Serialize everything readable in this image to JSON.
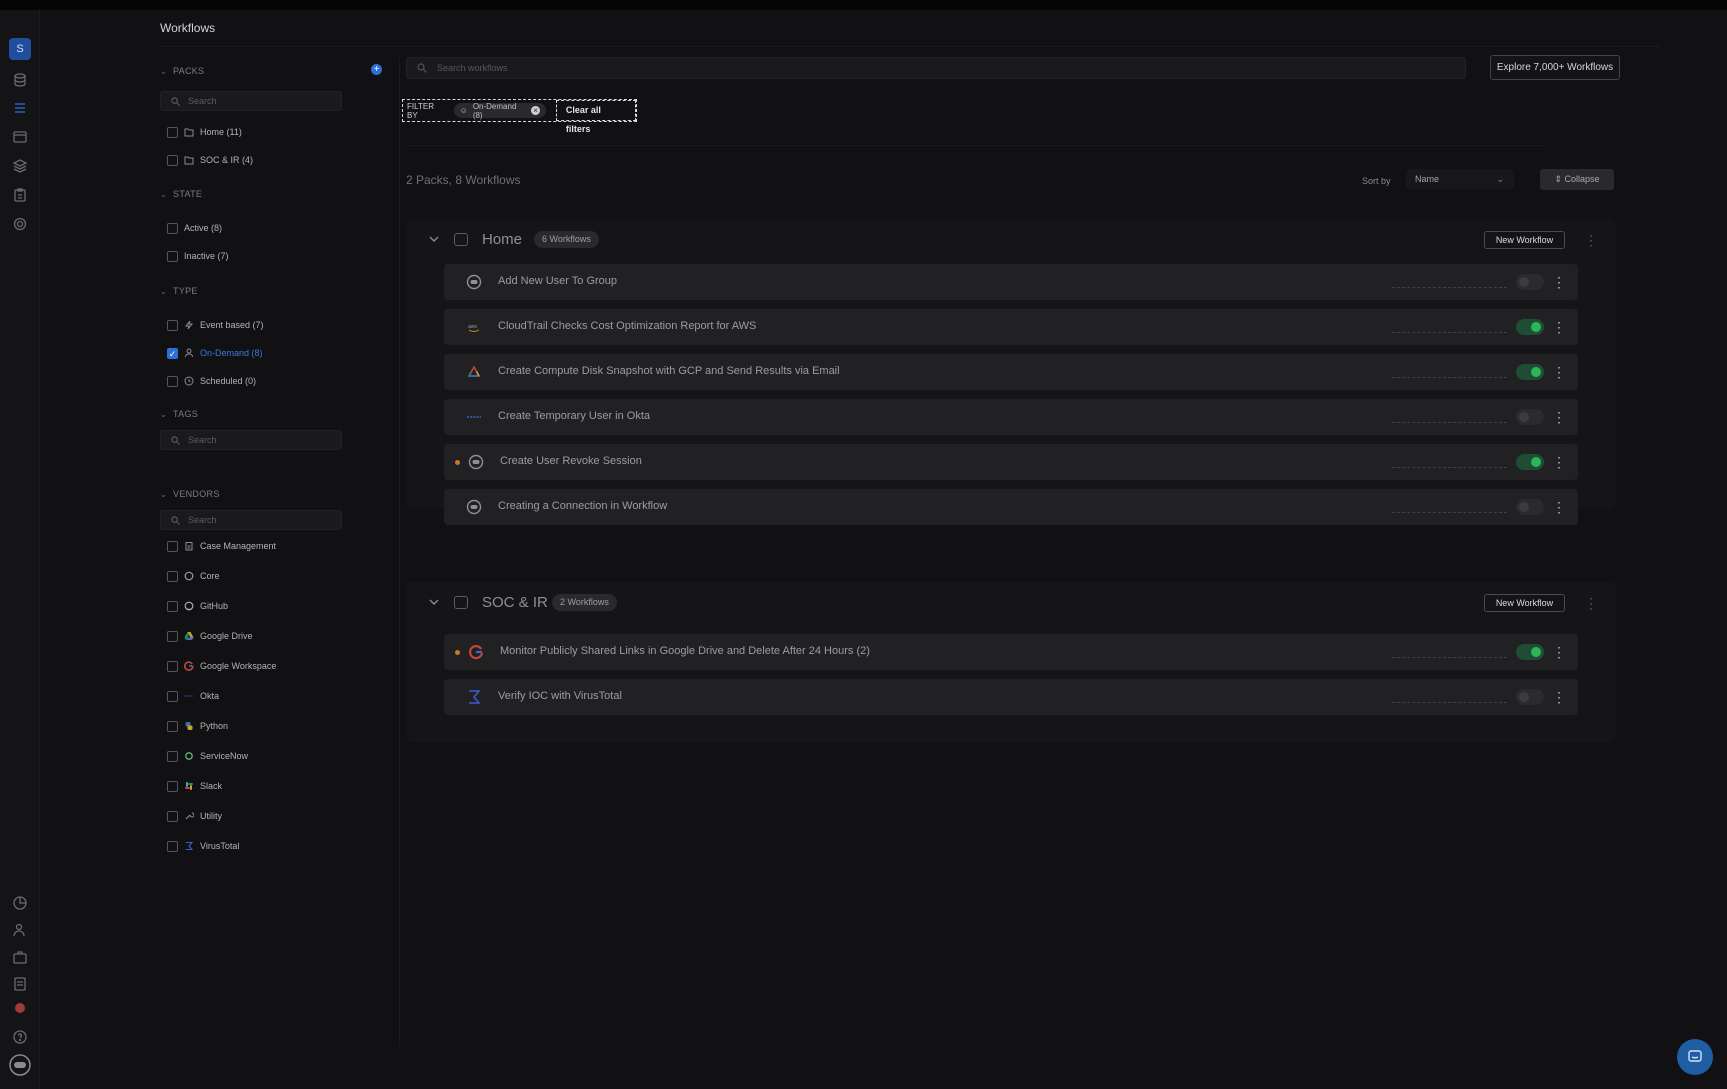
{
  "app": {
    "avatar_letter": "S",
    "page_title": "Workflows"
  },
  "sidebar": {
    "packs_label": "PACKS",
    "packs_search_placeholder": "Search",
    "packs": [
      {
        "label": "Home (11)",
        "checked": false
      },
      {
        "label": "SOC & IR (4)",
        "checked": false
      }
    ],
    "state_label": "STATE",
    "states": [
      {
        "label": "Active (8)",
        "checked": false
      },
      {
        "label": "Inactive (7)",
        "checked": false
      }
    ],
    "type_label": "TYPE",
    "types": [
      {
        "label": "Event based (7)",
        "icon": "bolt-icon",
        "checked": false
      },
      {
        "label": "On-Demand (8)",
        "icon": "user-icon",
        "checked": true
      },
      {
        "label": "Scheduled (0)",
        "icon": "clock-icon",
        "checked": false
      }
    ],
    "tags_label": "TAGS",
    "tags_search_placeholder": "Search",
    "vendors_label": "VENDORS",
    "vendors_search_placeholder": "Search",
    "vendors": [
      {
        "label": "Case Management",
        "icon": "clipboard-icon"
      },
      {
        "label": "Core",
        "icon": "core-icon"
      },
      {
        "label": "GitHub",
        "icon": "github-icon"
      },
      {
        "label": "Google Drive",
        "icon": "google-drive-icon"
      },
      {
        "label": "Google Workspace",
        "icon": "google-icon"
      },
      {
        "label": "Okta",
        "icon": "okta-icon"
      },
      {
        "label": "Python",
        "icon": "python-icon"
      },
      {
        "label": "ServiceNow",
        "icon": "servicenow-icon"
      },
      {
        "label": "Slack",
        "icon": "slack-icon"
      },
      {
        "label": "Utility",
        "icon": "wrench-icon"
      },
      {
        "label": "VirusTotal",
        "icon": "virustotal-icon"
      }
    ]
  },
  "search": {
    "placeholder": "Search workflows"
  },
  "explore_button": "Explore 7,000+ Workflows",
  "filter": {
    "label": "FILTER BY",
    "chip": "On-Demand (8)",
    "clear_label": "Clear all filters"
  },
  "summary": "2 Packs, 8 Workflows",
  "sort": {
    "label": "Sort by",
    "value": "Name"
  },
  "collapse_label": "Collapse",
  "packs": [
    {
      "name": "Home",
      "badge": "6  Workflows",
      "new_label": "New Workflow",
      "workflows": [
        {
          "title": "Add New User To Group",
          "icon": "core-icon",
          "active": false,
          "dot": false
        },
        {
          "title": "CloudTrail Checks Cost Optimization Report for AWS",
          "icon": "aws-icon",
          "active": true,
          "dot": false
        },
        {
          "title": "Create Compute Disk Snapshot with GCP and Send Results via Email",
          "icon": "gcp-icon",
          "active": true,
          "dot": false
        },
        {
          "title": "Create Temporary User in Okta",
          "icon": "okta-icon",
          "active": false,
          "dot": false
        },
        {
          "title": "Create User Revoke Session",
          "icon": "core-icon",
          "active": true,
          "dot": true
        },
        {
          "title": "Creating a Connection in Workflow",
          "icon": "core-icon",
          "active": false,
          "dot": false
        }
      ]
    },
    {
      "name": "SOC & IR",
      "badge": "2  Workflows",
      "new_label": "New Workflow",
      "workflows": [
        {
          "title": "Monitor Publicly Shared Links in Google Drive and Delete After 24 Hours (2)",
          "icon": "google-icon",
          "active": true,
          "dot": true
        },
        {
          "title": "Verify IOC with VirusTotal",
          "icon": "virustotal-icon",
          "active": false,
          "dot": false
        }
      ]
    }
  ],
  "colors": {
    "accent": "#2c6fd6",
    "toggle_on": "#2bb55c",
    "dot": "#c8762a"
  }
}
